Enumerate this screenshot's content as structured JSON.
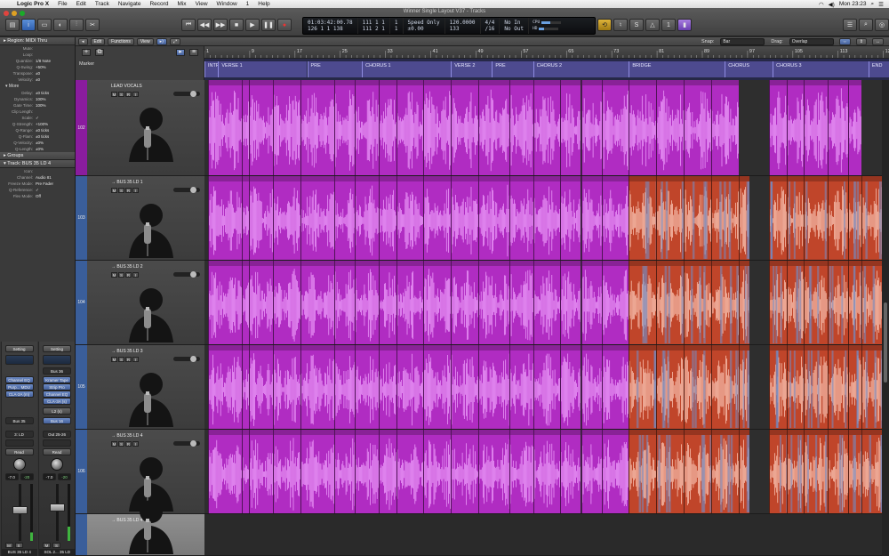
{
  "menubar": {
    "app": "Logic Pro X",
    "items": [
      "File",
      "Edit",
      "Track",
      "Navigate",
      "Record",
      "Mix",
      "View",
      "Window",
      "1",
      "Help"
    ],
    "clock": "Mon 23:23"
  },
  "window": {
    "title": "Winner Single Layout V37 - Tracks"
  },
  "lcd": {
    "time": "01:03:42:00.78",
    "time_sub": "126  1  1  138",
    "bars": "111  1  1",
    "bars2": "111  2  1",
    "beat": "1",
    "beat2": "1",
    "mode": "Speed Only",
    "mode_sub": "±0.00",
    "tempo": "120.0000",
    "tempo_sub": "133",
    "sig": "4/4",
    "sig_sub": "/16",
    "in": "No In",
    "out": "No Out",
    "cpu_label": "CPU",
    "hd_label": "HD",
    "cpu_level": 0.45,
    "hd_level": 0.25
  },
  "inspector": {
    "region_header": "Region: MIDI Thru",
    "rows": [
      {
        "k": "Mute:",
        "v": ""
      },
      {
        "k": "Loop:",
        "v": ""
      },
      {
        "k": "Quantize:",
        "v": "1/8 Note"
      },
      {
        "k": "Q-Swing:",
        "v": "+50%"
      },
      {
        "k": "Transpose:",
        "v": "±0"
      },
      {
        "k": "Velocity:",
        "v": "±0"
      }
    ],
    "more_label": "More",
    "more_rows": [
      {
        "k": "Delay:",
        "v": "±0 ticks"
      },
      {
        "k": "Dynamics:",
        "v": "100%"
      },
      {
        "k": "Gate Time:",
        "v": "100%"
      },
      {
        "k": "Clip Length:",
        "v": ""
      },
      {
        "k": "Scale:",
        "v": "✓"
      },
      {
        "k": "Q-Strength:",
        "v": "+100%"
      },
      {
        "k": "Q-Range:",
        "v": "±0 ticks"
      },
      {
        "k": "Q-Flam:",
        "v": "±0 ticks"
      },
      {
        "k": "Q-Velocity:",
        "v": "±0%"
      },
      {
        "k": "Q-Length:",
        "v": "±0%"
      }
    ],
    "groups_label": "Groups",
    "track_header": "Track: BUS 35 LD 4",
    "track_rows": [
      {
        "k": "Icon:",
        "v": ""
      },
      {
        "k": "Channel:",
        "v": "Audio 81"
      },
      {
        "k": "Freeze Mode:",
        "v": "Pre Fader"
      },
      {
        "k": "Q-Reference:",
        "v": "✓"
      },
      {
        "k": "Flex Mode:",
        "v": "Off"
      }
    ]
  },
  "strips": [
    {
      "setting": "Setting",
      "io_top": "",
      "plugins": [
        "Channel EQ",
        "Purp... MDU",
        "CLA-2A (m)"
      ],
      "bus_a": "",
      "bus_b": "",
      "extra": "Bus 35",
      "output": "3: LD",
      "mode": "Read",
      "vol": "-7.0",
      "vol2": "-20",
      "fader": 0.55,
      "meter": 0.15,
      "mute": "M",
      "solo": "S",
      "name": "BUS 35 LD 4"
    },
    {
      "setting": "Setting",
      "io_top": "Bus 36",
      "plugins": [
        "Kramer Tape",
        "Strip Pro",
        "Channel EQ",
        "CLA-3A (s)"
      ],
      "bus_a": "L2 (s)",
      "bus_b": "Bus 16",
      "extra": "",
      "output": "Out 25-26",
      "mode": "Read",
      "vol": "-7.0",
      "vol2": "-20",
      "fader": 0.6,
      "meter": 0.25,
      "mute": "M",
      "solo": "S",
      "name": "SOL 2... 35 LD"
    }
  ],
  "arr_toolbar": {
    "edit": "Edit",
    "functions": "Functions",
    "view": "View",
    "snap_label": "Snap:",
    "snap_value": "Bar",
    "drag_label": "Drag:",
    "drag_value": "Overlap"
  },
  "marker_label": "Marker",
  "ruler": [
    "1",
    "9",
    "17",
    "25",
    "33",
    "41",
    "49",
    "57",
    "65",
    "73",
    "81",
    "89",
    "97",
    "105",
    "113",
    "121"
  ],
  "markers": [
    {
      "name": "INTRO",
      "start": 0,
      "end": 2
    },
    {
      "name": "VERSE 1",
      "start": 2,
      "end": 15
    },
    {
      "name": "PRE",
      "start": 15,
      "end": 23
    },
    {
      "name": "CHORUS 1",
      "start": 23,
      "end": 36
    },
    {
      "name": "VERSE 2",
      "start": 36,
      "end": 42
    },
    {
      "name": "PRE",
      "start": 42,
      "end": 48
    },
    {
      "name": "CHORUS 2",
      "start": 48,
      "end": 62
    },
    {
      "name": "BRIDGE",
      "start": 62,
      "end": 76
    },
    {
      "name": "CHORUS",
      "start": 76,
      "end": 83
    },
    {
      "name": "CHORUS 3",
      "start": 83,
      "end": 97
    },
    {
      "name": "END",
      "start": 97,
      "end": 100
    }
  ],
  "tracks": [
    {
      "num": "102",
      "name": "LEAD VOCALS",
      "color": "#8a1c9e",
      "kind": "lead"
    },
    {
      "num": "103",
      "name": "→ BUS 35 LD 1",
      "color": "#3a5e9a",
      "kind": "bus"
    },
    {
      "num": "104",
      "name": "→ BUS 35 LD 2",
      "color": "#3a5e9a",
      "kind": "bus"
    },
    {
      "num": "105",
      "name": "→ BUS 35 LD 3",
      "color": "#3a5e9a",
      "kind": "bus"
    },
    {
      "num": "106",
      "name": "→ BUS 35 LD 4",
      "color": "#3a5e9a",
      "kind": "bus"
    },
    {
      "num": "",
      "name": "→ BUS 35 LD 4",
      "color": "#3a5e9a",
      "kind": "selected"
    }
  ],
  "track_buttons": [
    "M",
    "S",
    "R",
    "I"
  ],
  "colors": {
    "region_magenta": "#b02cc2",
    "wave_magenta": "#f2a6ff",
    "region_red": "#c0452a",
    "wave_red": "#ffd0c0",
    "region_blue": "#6f8dc7",
    "marker": "#4d4a8f"
  }
}
